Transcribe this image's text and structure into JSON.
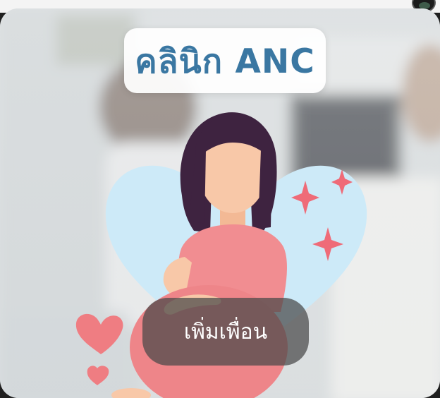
{
  "banner": {
    "title": "คลินิก ANC",
    "add_friend_label": "เพิ่มเพื่อน"
  },
  "icons": {
    "avatar": "profile-avatar-icon",
    "sparkle": "sparkle-icon",
    "heart": "heart-icon"
  },
  "colors": {
    "title_text": "#3a77a2",
    "heart_blue": "#cdeaf8",
    "dress_pink": "#f18d91",
    "hair": "#3e2340",
    "skin": "#f8c8a8",
    "sparkle_pink": "#ef6b78",
    "small_heart": "#ef7d82",
    "button_bg": "#484848"
  }
}
